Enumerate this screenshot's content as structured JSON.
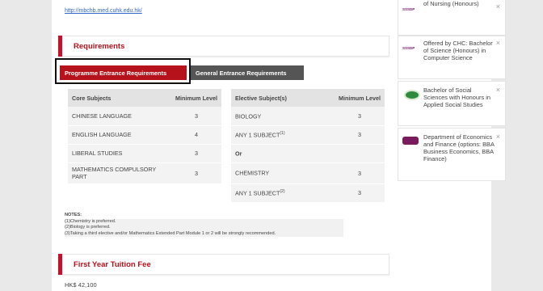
{
  "link": "http://mbchb.med.cuhk.edu.hk/",
  "requirements_title": "Requirements",
  "tabs": {
    "active": "Programme Entrance Requirements",
    "inactive": "General Entrance Requirements"
  },
  "core": {
    "headers": [
      "Core Subjects",
      "Minimum Level"
    ],
    "rows": [
      {
        "subject": "CHINESE LANGUAGE",
        "level": "3"
      },
      {
        "subject": "ENGLISH LANGUAGE",
        "level": "4"
      },
      {
        "subject": "LIBERAL STUDIES",
        "level": "3"
      },
      {
        "subject": "MATHEMATICS COMPULSORY PART",
        "level": "3"
      }
    ]
  },
  "elective": {
    "headers": [
      "Elective Subject(s)",
      "Minimum Level"
    ],
    "rows": [
      {
        "subject": "BIOLOGY",
        "sup": "",
        "level": "3"
      },
      {
        "subject": "ANY 1 SUBJECT",
        "sup": "(1)",
        "level": "3"
      },
      {
        "subject": "Or",
        "sup": "",
        "level": ""
      },
      {
        "subject": "CHEMISTRY",
        "sup": "",
        "level": "3"
      },
      {
        "subject": "ANY 1 SUBJECT",
        "sup": "(2)",
        "level": "3"
      }
    ]
  },
  "notes": {
    "title": "NOTES:",
    "lines": [
      "(1)Chemistry is preferred.",
      "(2)Biology is preferred.",
      "(3)Taking a third elective and/or Mathematics Extended Part Module 1 or 2 will be strongly recommended."
    ]
  },
  "fee_title": "First Year Tuition Fee",
  "fee_value": "HK$ 42,100",
  "sidebar": [
    {
      "logo": "SSSDP",
      "text": "Offered by CHC: Bachelor of Nursing (Honours)",
      "close": "×"
    },
    {
      "logo": "SSSDP",
      "text": "Offered by CHC: Bachelor of Science (Honours) in Computer Science",
      "close": "×"
    },
    {
      "logo": "",
      "text": "Bachelor of Social Sciences with Honours in Applied Social Studies",
      "close": "×"
    },
    {
      "logo": "CityU",
      "text": "Department of Economics and Finance (options: BBA Business Economics, BBA Finance)",
      "close": "×"
    }
  ]
}
